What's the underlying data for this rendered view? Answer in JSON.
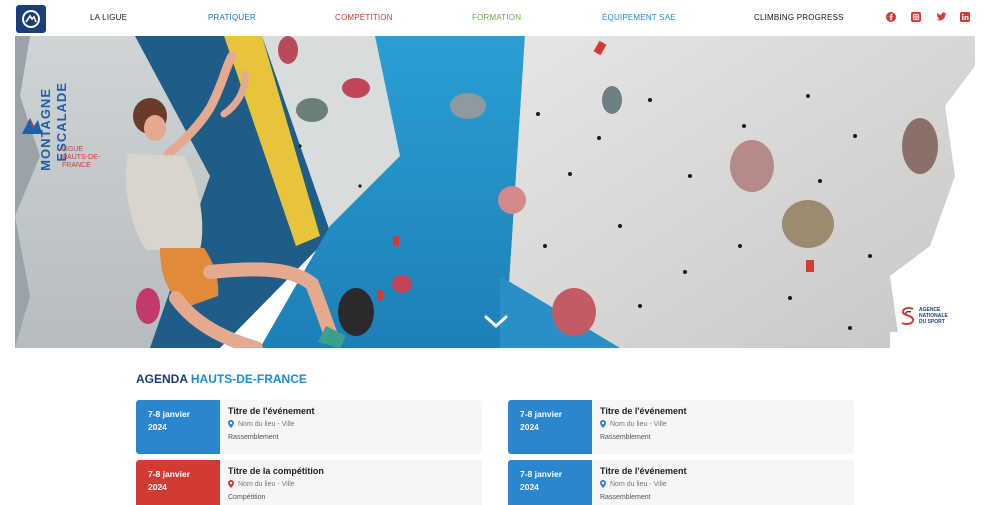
{
  "nav": {
    "items": [
      {
        "label": "LA LIGUE",
        "color": "#1a1a1a"
      },
      {
        "label": "PRATIQUER",
        "color": "#1d6fc4"
      },
      {
        "label": "COMPÉTITION",
        "color": "#d23a34"
      },
      {
        "label": "FORMATION",
        "color": "#6ea84a"
      },
      {
        "label": "ÉQUIPEMENT SAE",
        "color": "#1d8bd6"
      },
      {
        "label": "CLIMBING PROGRESS",
        "color": "#1a1a1a"
      }
    ],
    "social_icons": [
      "facebook-icon",
      "instagram-icon",
      "twitter-icon",
      "linkedin-icon"
    ],
    "social_color": "#d23a34"
  },
  "brand": {
    "line1": "MONTAGNE",
    "line2": "ESCALADE",
    "sub1": "LIGUE",
    "sub2": "HAUTS-DE-",
    "sub3": "FRANCE"
  },
  "partner": {
    "line1": "AGENCE",
    "line2": "NATIONALE",
    "line3": "DU SPORT"
  },
  "agenda": {
    "title_main": "AGENDA ",
    "title_accent": "HAUTS-DE-FRANCE",
    "events": [
      {
        "date_line1": "7-8 janvier",
        "date_line2": "2024",
        "title": "Titre de l'événement",
        "place": "Nom du lieu - Ville",
        "type": "Rassemblement",
        "color": "#2a86cf"
      },
      {
        "date_line1": "7-8 janvier",
        "date_line2": "2024",
        "title": "Titre de l'événement",
        "place": "Nom du lieu - Ville",
        "type": "Rassemblement",
        "color": "#2a86cf"
      },
      {
        "date_line1": "7-8 janvier",
        "date_line2": "2024",
        "title": "Titre de la compétition",
        "place": "Nom du lieu - Ville",
        "type": "Compétition",
        "color": "#d23a34"
      },
      {
        "date_line1": "7-8 janvier",
        "date_line2": "2024",
        "title": "Titre de l'événement",
        "place": "Nom du lieu - Ville",
        "type": "Rassemblement",
        "color": "#2a86cf"
      }
    ]
  }
}
